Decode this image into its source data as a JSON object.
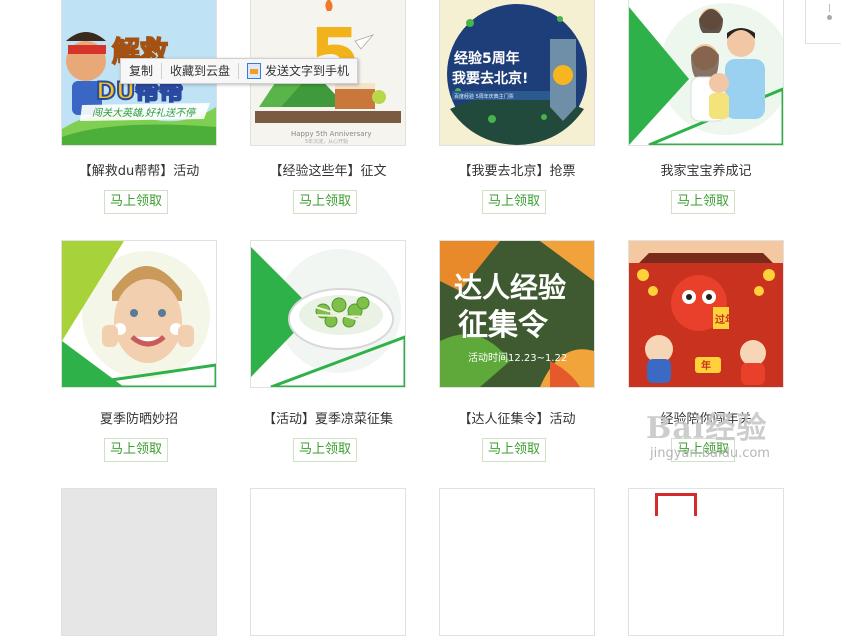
{
  "context_menu": {
    "copy": "复制",
    "save_to_cloud": "收藏到云盘",
    "send_to_phone": "发送文字到手机"
  },
  "cards_row1": [
    {
      "title": "【解救du帮帮】活动",
      "button": "马上领取",
      "art": {
        "banner_top": "解救",
        "banner_main": "DU帮帮",
        "ribbon": "闯关大英雄,好礼送不停"
      }
    },
    {
      "title": "【经验这些年】征文",
      "button": "马上领取",
      "art": {
        "number": "5",
        "caption": "Happy 5th Anniversary",
        "sub": "5年沉淀，从心开始"
      }
    },
    {
      "title": "【我要去北京】抢票",
      "button": "马上领取",
      "art": {
        "line1": "经验5周年",
        "line2": "我要去北京!",
        "sub": "百度经验 5周年庆典主门票"
      }
    },
    {
      "title": "我家宝宝养成记",
      "button": "马上领取",
      "art": {}
    }
  ],
  "cards_row2": [
    {
      "title": "夏季防晒妙招",
      "button": "马上领取",
      "art": {}
    },
    {
      "title": "【活动】夏季凉菜征集",
      "button": "马上领取",
      "art": {}
    },
    {
      "title": "【达人征集令】活动",
      "button": "马上领取",
      "art": {
        "line1": "达人经验",
        "line2": "征集令",
        "date": "活动时间12.23~1.22"
      }
    },
    {
      "title": "经验陪你闯年关",
      "button": "马上领取",
      "art": {
        "fu": "过年",
        "nian": "年"
      }
    }
  ],
  "watermark": {
    "logo": "Bai经验",
    "url": "jingyan.baidu.com"
  }
}
